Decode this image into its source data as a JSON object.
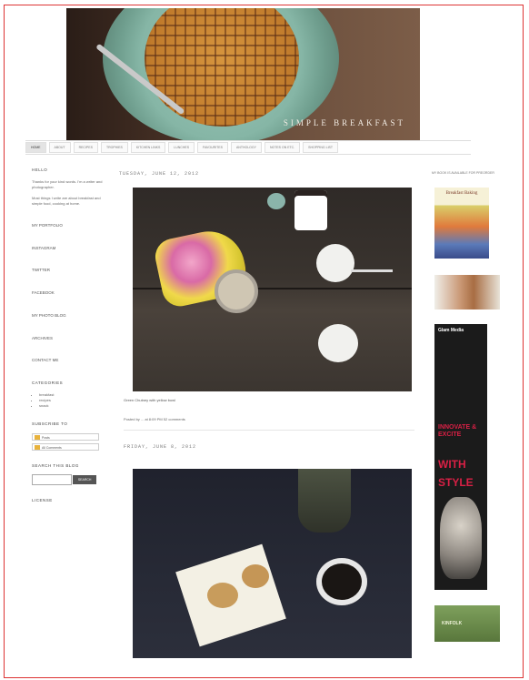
{
  "header": {
    "title": "SIMPLE BREAKFAST"
  },
  "nav": {
    "tabs": [
      "HOME",
      "ABOUT",
      "RECIPES",
      "TROPHIES",
      "KITCHEN LINKS",
      "LUNCHES",
      "FAVOURITES",
      "ANTHOLOGY",
      "NOTES ON ETC.",
      "SHOPPING LIST"
    ]
  },
  "left_sidebar": {
    "hello_heading": "HELLO",
    "hello_text": "Thanks for your kind words. I'm a writer and photographer.",
    "bio_text": "Most things I write are about breakfast and simple food, cooking at home.",
    "links": [
      "MY PORTFOLIO",
      "INSTAGRAM",
      "TWITTER",
      "FACEBOOK",
      "MY PHOTO BLOG",
      "ARCHIVES",
      "CONTACT ME"
    ],
    "categories_heading": "CATEGORIES",
    "categories": [
      "breakfast",
      "recipes",
      "snack"
    ],
    "subscribe_heading": "SUBSCRIBE TO",
    "subscribe_options": [
      "Posts",
      "All Comments"
    ],
    "search_heading": "SEARCH THIS BLOG",
    "search_placeholder": "",
    "search_button": "SEARCH",
    "license_heading": "LICENSE"
  },
  "posts": [
    {
      "date": "TUESDAY, JUNE 12, 2012",
      "caption": "Green Chutney with yellow bowl",
      "meta": "Posted by ... at 8:09 PM   52 comments"
    },
    {
      "date": "FRIDAY, JUNE 8, 2012"
    }
  ],
  "right_sidebar": {
    "heading": "MY BOOK IS AVAILABLE FOR PREORDER",
    "book_title": "Breakfast Baking",
    "ad_brand": "Glam Media",
    "ad_line1": "INNOVATE & EXCITE",
    "ad_line2": "WITH",
    "ad_line3": "STYLE",
    "badge_label": "KINFOLK"
  }
}
